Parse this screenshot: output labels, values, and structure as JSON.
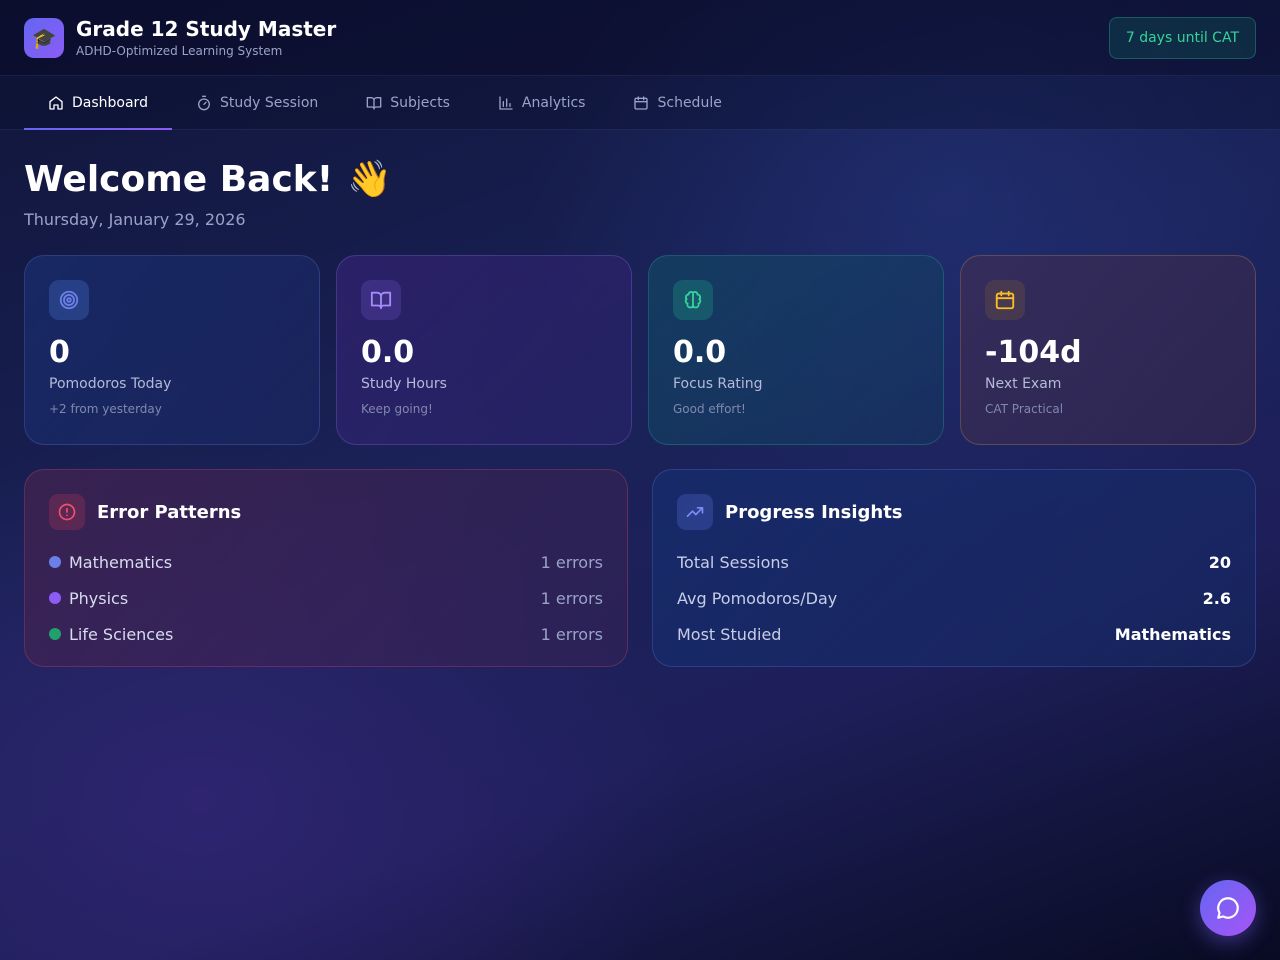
{
  "header": {
    "title": "Grade 12 Study Master",
    "subtitle": "ADHD-Optimized Learning System",
    "logo_icon": "graduation-cap-icon",
    "countdown": "7 days until CAT"
  },
  "nav": {
    "tabs": [
      {
        "label": "Dashboard",
        "icon": "home-icon",
        "active": true
      },
      {
        "label": "Study Session",
        "icon": "timer-icon",
        "active": false
      },
      {
        "label": "Subjects",
        "icon": "book-open-icon",
        "active": false
      },
      {
        "label": "Analytics",
        "icon": "bar-chart-icon",
        "active": false
      },
      {
        "label": "Schedule",
        "icon": "calendar-icon",
        "active": false
      }
    ]
  },
  "welcome": {
    "title": "Welcome Back!",
    "emoji": "👋",
    "date": "Thursday, January 29, 2026"
  },
  "stats": [
    {
      "value": "0",
      "label": "Pomodoros Today",
      "note": "+2 from yesterday",
      "icon": "target-icon",
      "color": "#6b7fe8"
    },
    {
      "value": "0.0",
      "label": "Study Hours",
      "note": "Keep going!",
      "icon": "book-open-icon",
      "color": "#a78bfa"
    },
    {
      "value": "0.0",
      "label": "Focus Rating",
      "note": "Good effort!",
      "icon": "brain-icon",
      "color": "#34d399"
    },
    {
      "value": "-104d",
      "label": "Next Exam",
      "note": "CAT Practical",
      "icon": "calendar-icon",
      "color": "#fbbf24"
    }
  ],
  "error_patterns": {
    "title": "Error Patterns",
    "icon": "alert-circle-icon",
    "items": [
      {
        "subject": "Mathematics",
        "count": "1 errors",
        "color": "#6b7fe8"
      },
      {
        "subject": "Physics",
        "count": "1 errors",
        "color": "#8b5cf6"
      },
      {
        "subject": "Life Sciences",
        "count": "1 errors",
        "color": "#22a06b"
      }
    ]
  },
  "progress_insights": {
    "title": "Progress Insights",
    "icon": "trending-up-icon",
    "items": [
      {
        "label": "Total Sessions",
        "value": "20"
      },
      {
        "label": "Avg Pomodoros/Day",
        "value": "2.6"
      },
      {
        "label": "Most Studied",
        "value": "Mathematics"
      }
    ]
  },
  "chat": {
    "icon": "chat-bubble-icon"
  }
}
